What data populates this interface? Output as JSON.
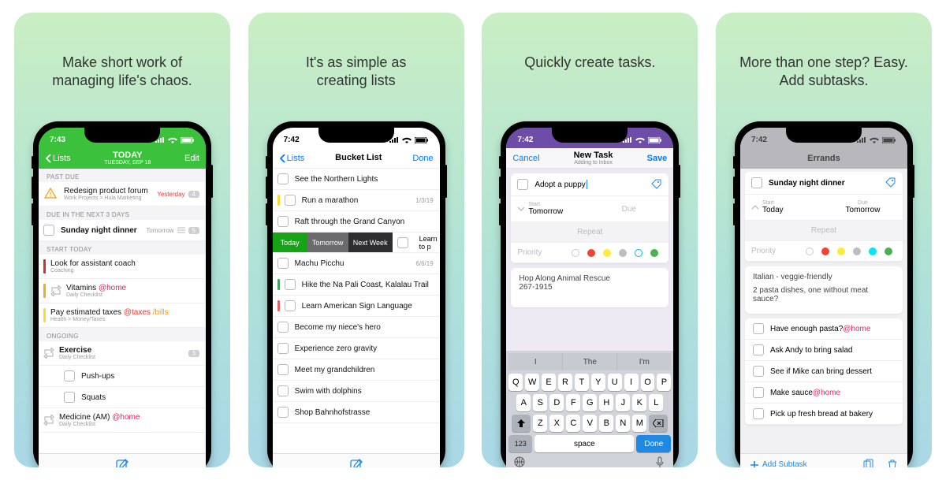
{
  "captions": [
    "Make short work of\nmanaging life's chaos.",
    "It's as simple as\ncreating lists",
    "Quickly create tasks.",
    "More than one step? Easy.\nAdd subtasks."
  ],
  "status_time": {
    "a": "7:43",
    "b": "7:42",
    "c": "7:42",
    "d": "7:42"
  },
  "s1": {
    "back": "Lists",
    "title": "TODAY",
    "subtitle": "TUESDAY, SEP 18",
    "edit": "Edit",
    "sec_past": "PAST DUE",
    "past": {
      "title": "Redesign product forum",
      "sub": "Work Projects > Hula Marketing",
      "when": "Yesterday",
      "count": "4"
    },
    "sec_next3": "DUE IN THE NEXT 3 DAYS",
    "next3": {
      "title": "Sunday night dinner",
      "when": "Tomorrow",
      "count": "5"
    },
    "sec_start": "START TODAY",
    "start": [
      {
        "title": "Look for assistant coach",
        "sub": "Coaching",
        "strip": "#d32f2f"
      },
      {
        "title_parts": [
          "Vitamins ",
          "@home"
        ],
        "sub": "Daily Checklist",
        "strip": "#f9a825",
        "repeat": true,
        "tagcolor": "#e91e63"
      },
      {
        "title_parts": [
          "Pay estimated taxes ",
          "@taxes ",
          "/bills"
        ],
        "sub": "Health > Money/Taxes",
        "strip": "#fdd835",
        "tagcolors": [
          "#e53935",
          "#ff9800"
        ]
      }
    ],
    "sec_ongoing": "ONGOING",
    "ongoing": {
      "title": "Exercise",
      "sub": "Daily Checklist",
      "count": "3"
    },
    "sub1": "Push-ups",
    "sub2": "Squats",
    "med": {
      "title_parts": [
        "Medicine (AM) ",
        "@home"
      ],
      "sub": "Daily Checklist",
      "tagcolor": "#e91e63"
    }
  },
  "s2": {
    "back": "Lists",
    "title": "Bucket List",
    "done": "Done",
    "rows": [
      {
        "t": "See the Northern Lights"
      },
      {
        "t": "Run a marathon",
        "r": "1/3/19",
        "strip": "#fdd835"
      },
      {
        "t": "Raft through the Grand Canyon"
      }
    ],
    "swipe": {
      "today": "Today",
      "tomorrow": "Tomorrow",
      "next": "Next Week",
      "hidden": "Learn to p"
    },
    "rows2": [
      {
        "t": "Machu Picchu",
        "r": "6/6/19"
      },
      {
        "t": "Hike the Na Pali Coast, Kalalau Trail",
        "strip": "#3da35d"
      },
      {
        "t": "Learn American Sign Language",
        "strip": "#e06666"
      },
      {
        "t": "Become my niece's hero"
      },
      {
        "t": "Experience zero gravity"
      },
      {
        "t": "Meet my grandchildren"
      },
      {
        "t": "Swim with dolphins"
      },
      {
        "t": "Shop Bahnhofstrasse"
      }
    ]
  },
  "s3": {
    "cancel": "Cancel",
    "title": "New Task",
    "subtitle": "Adding to Inbox",
    "save": "Save",
    "task": "Adopt a puppy",
    "start_lbl": "Start",
    "start_val": "Tomorrow",
    "due_lbl": "Due",
    "repeat": "Repeat",
    "priority": "Priority",
    "dots": [
      "#ffffff",
      "#f44336",
      "#ffeb3b",
      "#bdbdbd",
      "#00bcd4",
      "#4caf50"
    ],
    "note1": "Hop Along Animal Rescue",
    "note2": "267-1915",
    "pred": [
      "I",
      "The",
      "I'm"
    ],
    "keys1": [
      "Q",
      "W",
      "E",
      "R",
      "T",
      "Y",
      "U",
      "I",
      "O",
      "P"
    ],
    "keys2": [
      "A",
      "S",
      "D",
      "F",
      "G",
      "H",
      "J",
      "K",
      "L"
    ],
    "keys3": [
      "Z",
      "X",
      "C",
      "V",
      "B",
      "N",
      "M"
    ],
    "num": "123",
    "space": "space",
    "done": "Done"
  },
  "s4": {
    "title": "Errands",
    "task": "Sunday night dinner",
    "start_lbl": "Start",
    "start_val": "Today",
    "due_lbl": "Due",
    "due_val": "Tomorrow",
    "repeat": "Repeat",
    "priority": "Priority",
    "dots": [
      "#ffffff",
      "#f44336",
      "#ffeb3b",
      "#bdbdbd",
      "#00e5ff",
      "#4caf50"
    ],
    "note1": "Italian - veggie-friendly",
    "note2": "2 pasta dishes, one without meat sauce?",
    "subs": [
      {
        "parts": [
          "Have enough pasta? ",
          "@home"
        ],
        "color": "#e91e63"
      },
      {
        "parts": [
          "Ask Andy to bring salad"
        ]
      },
      {
        "parts": [
          "See if Mike can bring dessert"
        ]
      },
      {
        "parts": [
          "Make sauce ",
          "@home"
        ],
        "color": "#e91e63"
      },
      {
        "parts": [
          "Pick up fresh bread at bakery"
        ]
      }
    ],
    "add": "Add Subtask"
  }
}
